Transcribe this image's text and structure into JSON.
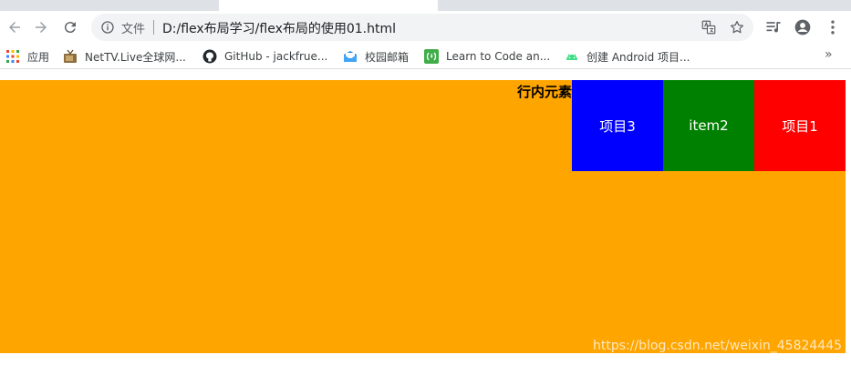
{
  "toolbar": {
    "security_label": "文件",
    "url": "D:/flex布局学习/flex布局的使用01.html"
  },
  "bookmarks": [
    {
      "label": "应用",
      "icon": "apps-grid-icon"
    },
    {
      "label": "NetTV.Live全球网...",
      "icon": "tv-icon"
    },
    {
      "label": "GitHub - jackfrue...",
      "icon": "github-icon"
    },
    {
      "label": "校园邮箱",
      "icon": "mail-icon"
    },
    {
      "label": "Learn to Code an...",
      "icon": "freecodecamp-icon"
    },
    {
      "label": "创建 Android 项目...",
      "icon": "android-icon"
    }
  ],
  "page": {
    "inline_text": "行内元素",
    "items": [
      {
        "label": "项目1",
        "color": "#ff0000"
      },
      {
        "label": "item2",
        "color": "#008000"
      },
      {
        "label": "项目3",
        "color": "#0000ff"
      }
    ],
    "background": "#ffa500"
  },
  "watermark": "https://blog.csdn.net/weixin_45824445"
}
